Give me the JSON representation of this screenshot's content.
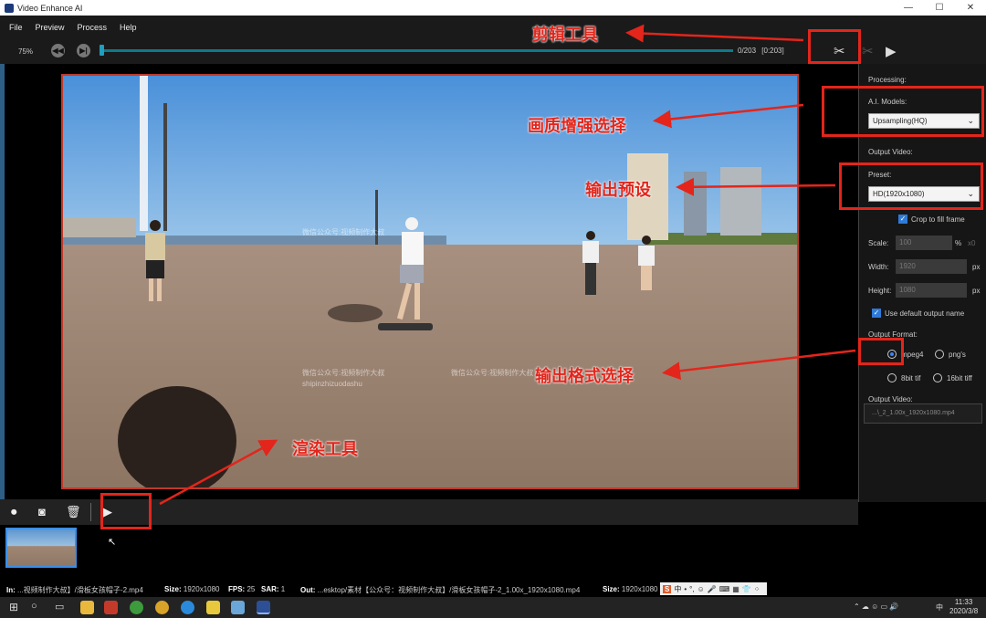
{
  "window": {
    "title": "Video Enhance AI",
    "controls": [
      "—",
      "☐",
      "✕"
    ]
  },
  "menu": [
    "File",
    "Preview",
    "Process",
    "Help"
  ],
  "toolbar": {
    "zoom": "75%",
    "frames": "0/203",
    "frame_range": "[0:203]",
    "progress": 0.0
  },
  "right_panel": {
    "processing_label": "Processing:",
    "ai_models_label": "A.I. Models:",
    "ai_model_value": "Upsampling(HQ)",
    "output_video_label": "Output Video:",
    "preset_label": "Preset:",
    "preset_value": "HD(1920x1080)",
    "crop_label": "Crop to fill frame",
    "scale_label": "Scale:",
    "scale_value": "100",
    "scale_unit": "%",
    "scale_extra": "x0",
    "width_label": "Width:",
    "width_value": "1920",
    "height_label": "Height:",
    "height_value": "1080",
    "px": "px",
    "default_name_label": "Use default output name",
    "output_format_label": "Output Format:",
    "formats": [
      "mpeg4",
      "png's",
      "8bit tif",
      "16bit tiff"
    ],
    "selected_format": "mpeg4",
    "output_video_path_label": "Output Video:",
    "output_video_path": "...\\_2_1.00x_1920x1080.mp4"
  },
  "status": {
    "in_label": "In:",
    "in_value": "...视频制作大叔】/滑板女孩帽子-2.mp4",
    "size_label": "Size:",
    "size_value": "1920x1080",
    "fps_label": "FPS:",
    "fps_value": "25",
    "sar_label": "SAR:",
    "sar_value": "1",
    "out_label": "Out:",
    "out_value": "...esktop/素材【公众号：视频制作大叔】/滑板女孩帽子-2_1.00x_1920x1080.mp4",
    "out_size_label": "Size:",
    "out_size_value": "1920x1080"
  },
  "ime": {
    "s": "S",
    "items": [
      "中",
      "•",
      "°,",
      "☺",
      "🎤",
      "⌨",
      "▦",
      "👕",
      "⁘"
    ]
  },
  "taskbar": {
    "time": "11:33",
    "date": "2020/3/8",
    "lang": "中"
  },
  "video": {
    "watermark1": "微信公众号:视频制作大叔",
    "watermark2": "shipinzhizuodashu"
  },
  "annotations": {
    "cut_tool": "剪辑工具",
    "quality_select": "画质增强选择",
    "output_preset": "输出预设",
    "format_select": "输出格式选择",
    "render_tool": "渲染工具"
  },
  "colors": {
    "annotation_red": "#e3251b",
    "progress": "#0e7a8c",
    "accent_blue": "#2f7ad8"
  }
}
